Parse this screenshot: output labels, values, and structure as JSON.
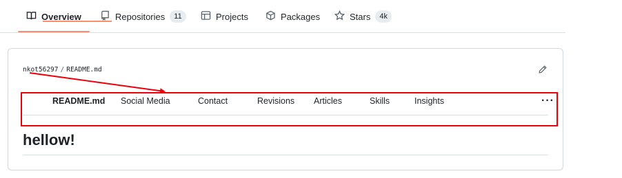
{
  "profile_nav": {
    "items": [
      {
        "label": "Overview",
        "icon": "book-icon"
      },
      {
        "label": "Repositories",
        "icon": "repo-icon",
        "count": "11"
      },
      {
        "label": "Projects",
        "icon": "table-icon"
      },
      {
        "label": "Packages",
        "icon": "package-icon"
      },
      {
        "label": "Stars",
        "icon": "star-icon",
        "count": "4k"
      }
    ]
  },
  "readme": {
    "breadcrumb": {
      "owner": "nkot56297",
      "separator": "/",
      "file": "README.md"
    },
    "tabs": [
      "README.md",
      "Social Media",
      "Contact",
      "Revisions",
      "Articles",
      "Skills",
      "Insights"
    ],
    "more_label": "···",
    "heading": "hellow!"
  },
  "colors": {
    "accent_underline": "#fd8c73",
    "annotation_red": "#e8000b",
    "border": "#d0d7de",
    "counter_bg": "#e7ecf0"
  }
}
